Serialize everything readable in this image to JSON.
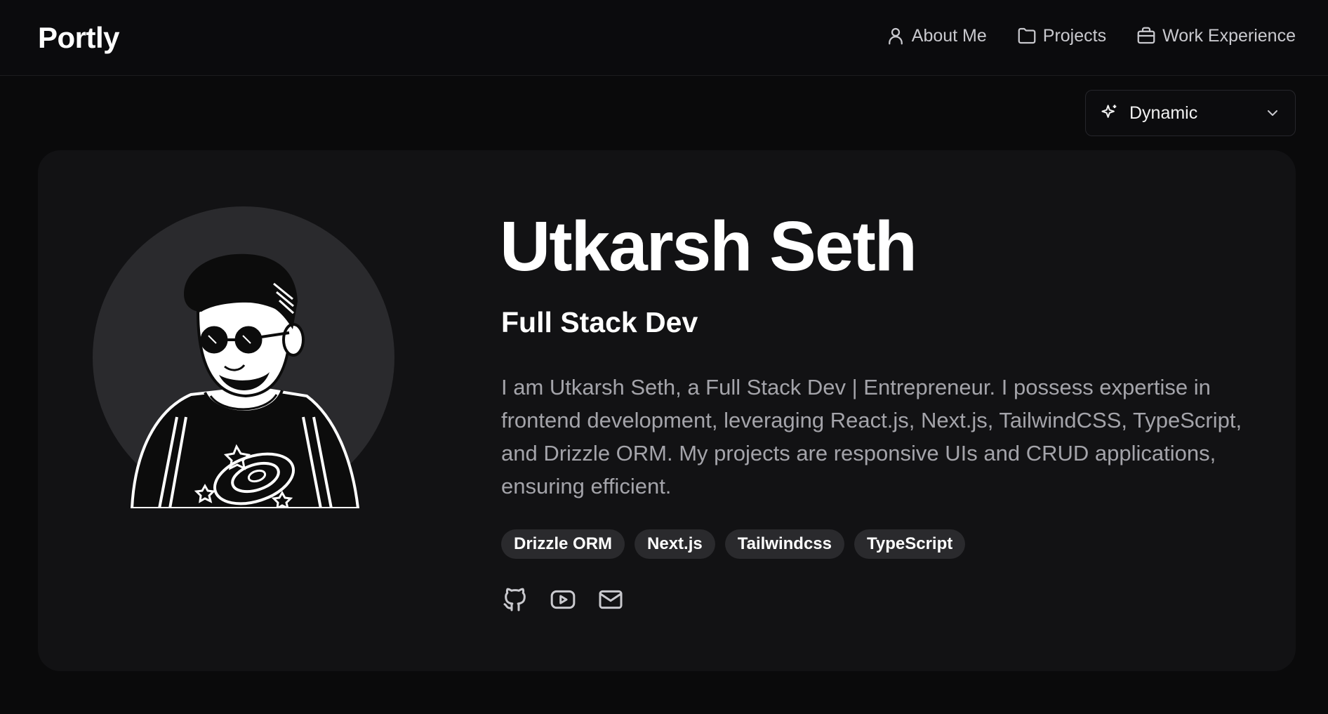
{
  "brand": "Portly",
  "nav": {
    "about": "About Me",
    "projects": "Projects",
    "work": "Work Experience"
  },
  "theme_select": {
    "value": "Dynamic"
  },
  "profile": {
    "name": "Utkarsh Seth",
    "role": "Full Stack Dev",
    "bio": "I am Utkarsh Seth, a Full Stack Dev | Entrepreneur. I possess expertise in frontend development, leveraging React.js, Next.js, TailwindCSS, TypeScript, and Drizzle ORM. My projects are responsive UIs and CRUD applications, ensuring efficient.",
    "tags": [
      "Drizzle ORM",
      "Next.js",
      "Tailwindcss",
      "TypeScript"
    ]
  },
  "socials": {
    "icons": [
      "github-icon",
      "youtube-icon",
      "mail-icon"
    ]
  },
  "colors": {
    "background": "#0a0a0b",
    "card": "#121214",
    "tag_bg": "#2a2a2d",
    "muted_text": "#a4a4aa"
  }
}
